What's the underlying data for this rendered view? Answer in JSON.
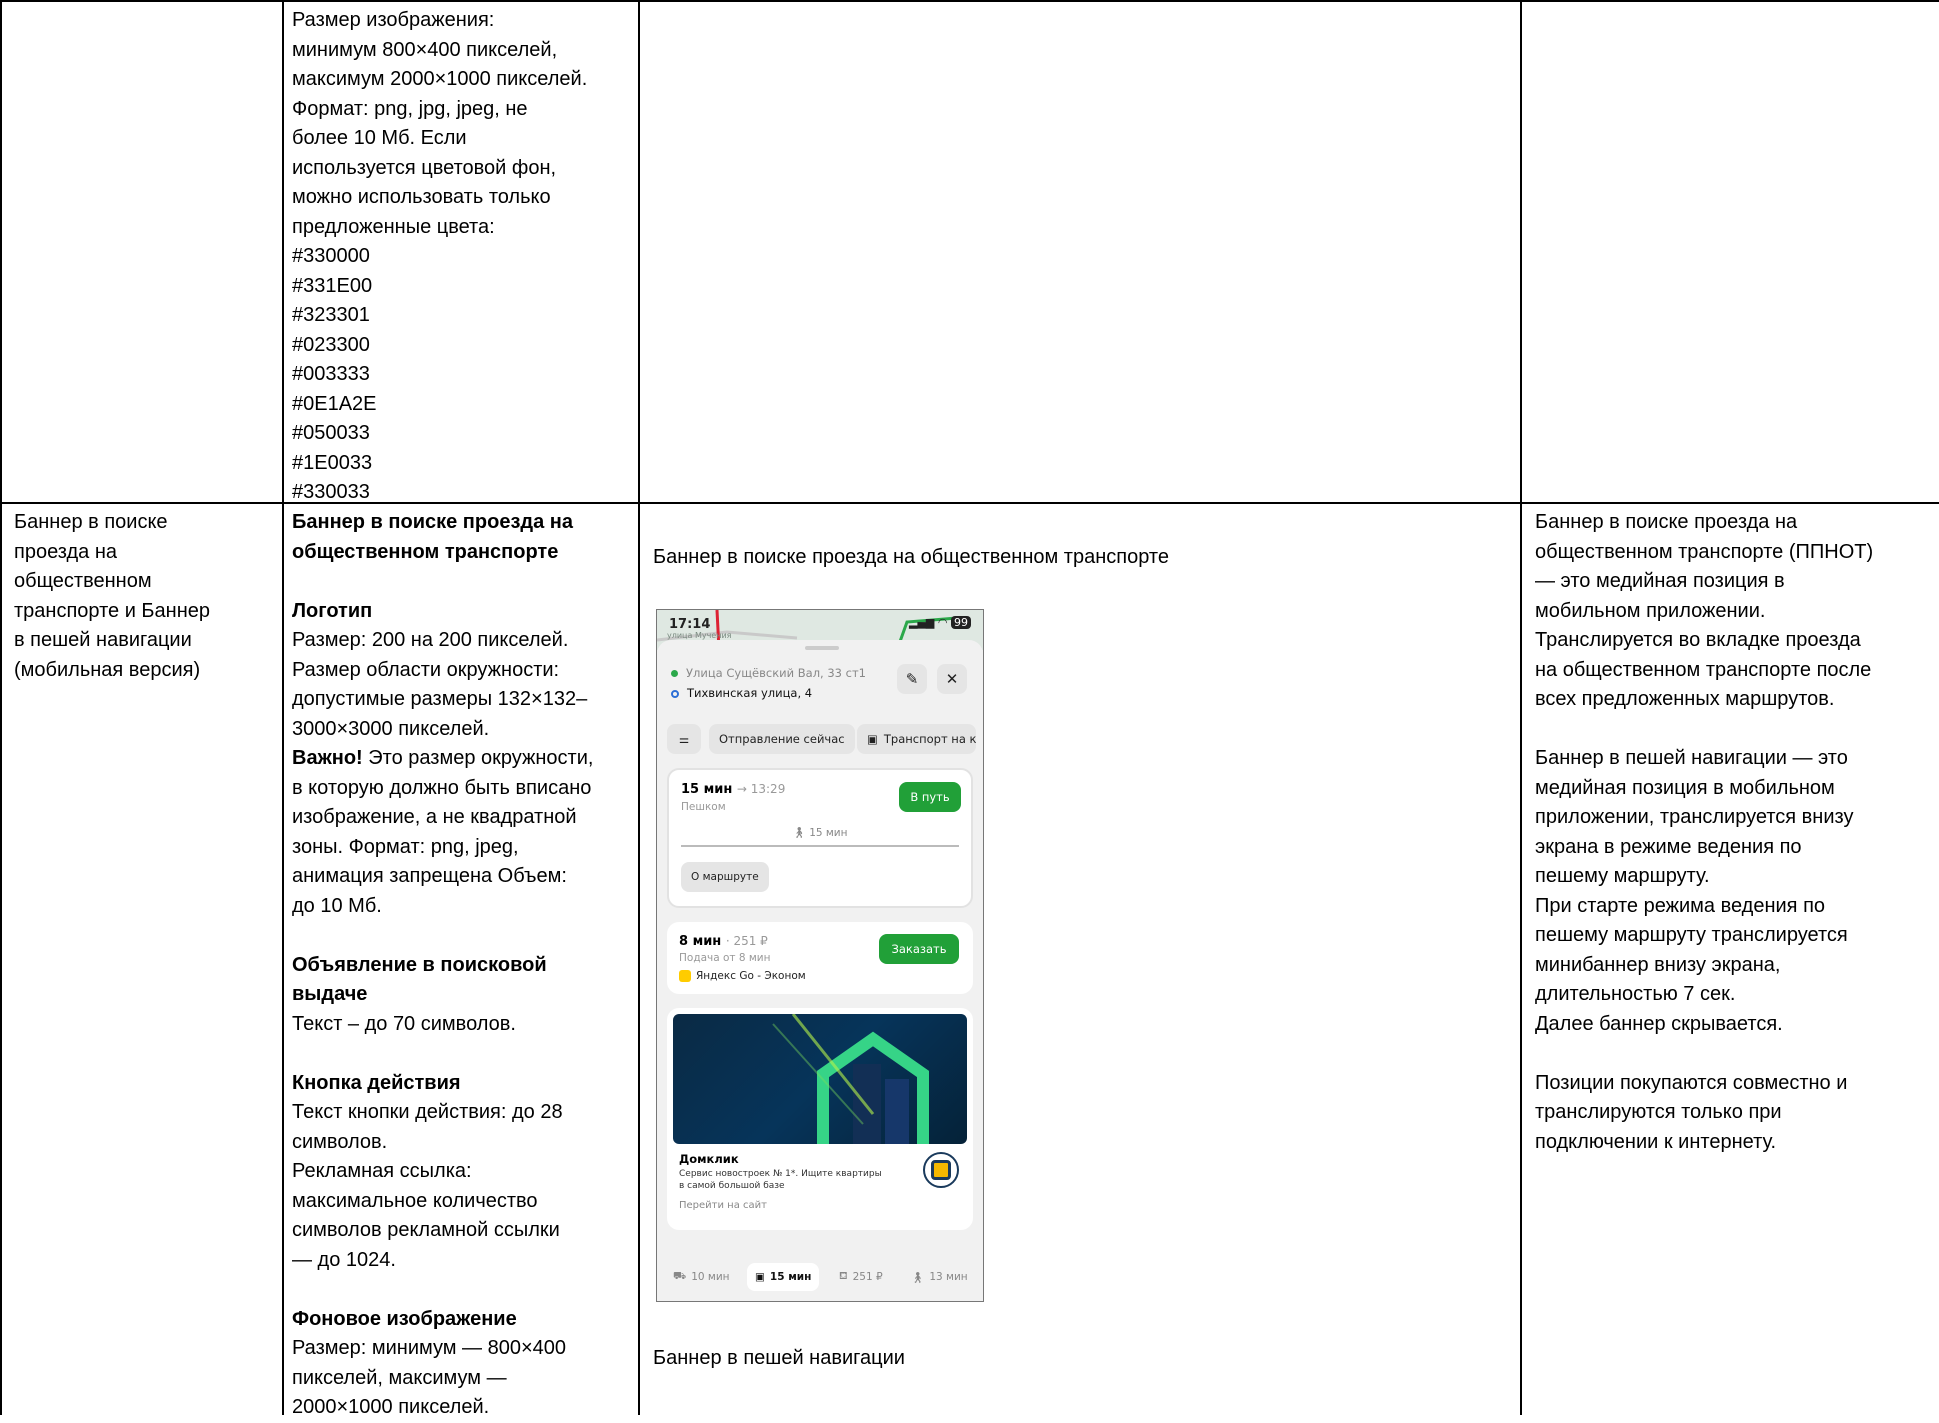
{
  "row1": {
    "spec_lines": [
      "Размер изображения:",
      "минимум 800×400 пикселей,",
      "максимум 2000×1000 пикселей.",
      "Формат: png, jpg, jpeg, не",
      "более 10 Мб. Если",
      "используется цветовой фон,",
      "можно использовать только",
      "предложенные цвета:",
      "#330000",
      "#331E00",
      "#323301",
      "#023300",
      "#003333",
      "#0E1A2E",
      "#050033",
      "#1E0033",
      "#330033"
    ]
  },
  "row2": {
    "name_lines": [
      "Баннер в поиске",
      "проезда на",
      "общественном",
      "транспорте и Баннер",
      "в пешей навигации",
      "(мобильная версия)"
    ],
    "spec": {
      "title_lines": [
        "Баннер в поиске проезда на",
        "общественном транспорте"
      ],
      "logo_heading": "Логотип",
      "logo_lines_1": [
        "Размер: 200 на 200 пикселей.",
        "Размер области окружности:",
        "допустимые размеры 132×132–",
        "3000×3000 пикселей."
      ],
      "important_label": "Важно!",
      "important_rest": " Это размер окружности,",
      "logo_lines_2": [
        "в которую должно быть вписано",
        "изображение, а не квадратной",
        "зоны. Формат: png, jpeg,",
        "анимация запрещена Объем:",
        "до 10 Мб."
      ],
      "ad_heading_lines": [
        "Объявление в поисковой",
        "выдаче"
      ],
      "ad_text": "Текст – до 70 символов.",
      "button_heading": "Кнопка действия",
      "button_lines": [
        "Текст кнопки действия: до 28",
        "символов.",
        "Рекламная ссылка:",
        "максимальное количество",
        "символов рекламной ссылки",
        "— до 1024."
      ],
      "bg_heading": "Фоновое изображение",
      "bg_lines": [
        "Размер: минимум — 800×400",
        "пикселей, максимум —",
        "2000×1000 пикселей."
      ]
    },
    "example": {
      "caption_top": "Баннер в поиске проезда на общественном транспорте",
      "caption_bottom": "Баннер в пешей навигации",
      "phone": {
        "time": "17:14",
        "map_label": "улица Мучения",
        "battery": "99",
        "from": "Улица Сущёвский Вал, 33 ст1",
        "to": "Тихвинская улица, 4",
        "chip_departure": "Отправление сейчас",
        "chip_transport": "Транспорт на к",
        "walk_time": "15 мин",
        "walk_arrival": "→ 13:29",
        "walk_mode": "Пешком",
        "go_button": "В путь",
        "walk_segment": "15 мин",
        "about_route": "О маршруте",
        "taxi_time": "8 мин",
        "taxi_price": "· 251 ₽",
        "taxi_pickup": "Подача от 8 мин",
        "order_button": "Заказать",
        "taxi_service": "Яндекс Go - Эконом",
        "ad_brand": "Домклик",
        "ad_text_1": "Сервис новостроек № 1*. Ищите квартиры",
        "ad_text_2": "в самой большой базе",
        "ad_link": "Перейти на сайт",
        "tabs": [
          "10 мин",
          "15 мин",
          "251 ₽",
          "13 мин"
        ]
      }
    },
    "description_lines_1": [
      "Баннер в поиске проезда на",
      "общественном транспорте (ППНОТ)",
      "— это медийная позиция в",
      "мобильном приложении.",
      "Транслируется во вкладке проезда",
      "на общественном транспорте после",
      "всех предложенных маршрутов."
    ],
    "description_lines_2": [
      "Баннер в пешей навигации — это",
      "медийная позиция в мобильном",
      "приложении, транслируется внизу",
      "экрана в режиме ведения по",
      "пешему маршруту.",
      "При старте режима ведения по",
      "пешему маршруту транслируется",
      "минибаннер внизу экрана,",
      "длительностью 7 сек.",
      "Далее баннер скрывается."
    ],
    "description_lines_3": [
      "Позиции покупаются совместно и",
      "транслируются только при",
      "подключении к интернету."
    ]
  }
}
